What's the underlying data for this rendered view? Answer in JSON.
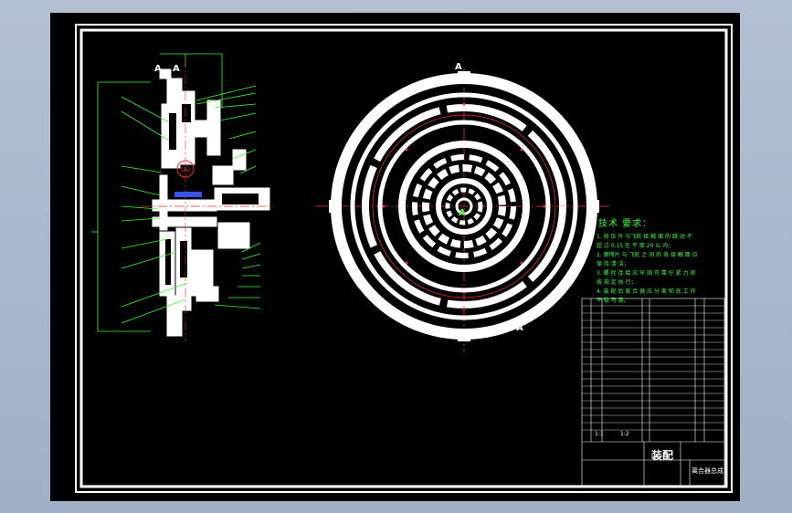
{
  "drawing": {
    "section_marker": "A",
    "center_marker": "A",
    "detail_marker": "A",
    "tech_requirements_title": "技术 要求：",
    "tech_requirements": [
      "1. 按 压 片 与飞轮 接 触 面 的 跳 动 不",
      "   超 过 0.15 在 平 面 20 以 内；",
      "2. 摩擦片 与 飞轮 之 间 的 各 接 触 面 应",
      "   保 持 清 洁；",
      "3. 螺 栓 连 接 应 牢 固 可 靠 拧 紧 力 矩",
      "   按 规 定 执 行；",
      "4. 装 配 后 离 合 器 应 分 离 彻 底 工 作",
      "   平 稳 可 靠。"
    ],
    "title_block": {
      "assembly_label": "装配",
      "drawing_name": "离合器总成",
      "scale_label": "1:1",
      "sheet_label": "1:2"
    }
  },
  "colors": {
    "canvas": "#000000",
    "frame": "#ffffff",
    "part": "#ffffff",
    "leader": "#33ff33",
    "centerline": "#ff2a2a",
    "accent": "#3355ff"
  }
}
